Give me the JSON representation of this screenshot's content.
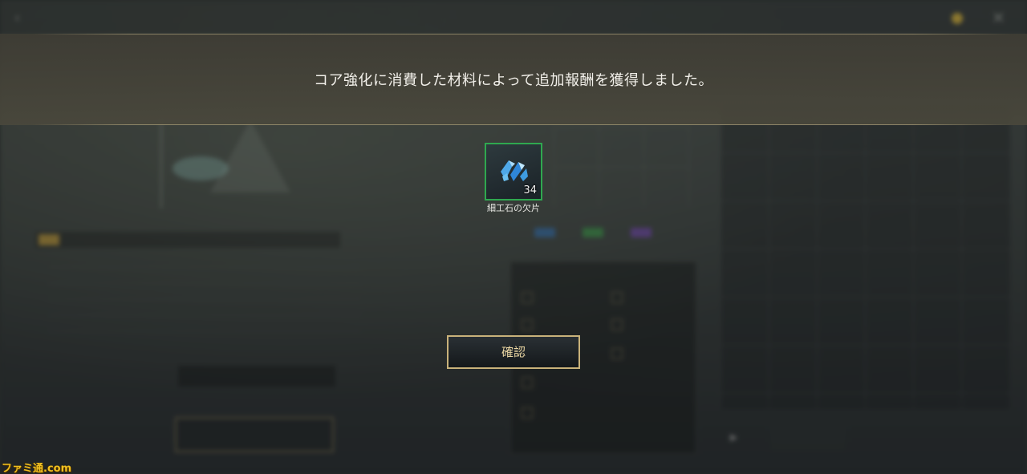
{
  "dialog": {
    "message": "コア強化に消費した材料によって追加報酬を獲得しました。",
    "reward": {
      "name": "細工石の欠片",
      "count": "34",
      "icon": "blue-gem-shards-icon",
      "border_color": "#2fa84f"
    },
    "confirm_label": "確認"
  },
  "watermark": "ファミ通.com",
  "colors": {
    "accent_gold": "#c9b27a",
    "confirm_text": "#e9d5a2",
    "reward_border": "#2fa84f"
  }
}
